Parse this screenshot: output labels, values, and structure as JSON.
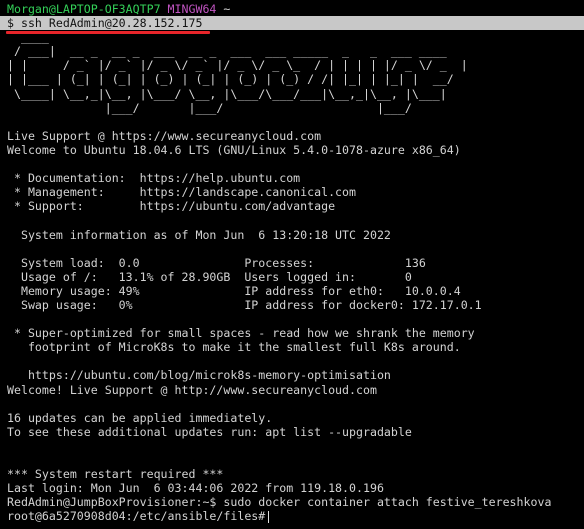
{
  "prompt": {
    "user_host": "Morgan@LAPTOP-OF3AQTP7",
    "shell": "MINGW64",
    "cwd": "~"
  },
  "command": "$ ssh RedAdmin@20.28.152.175",
  "colors": {
    "background": "#000000",
    "text": "#d3d3d3",
    "prompt_user": "#34d058",
    "prompt_shell": "#c154c1",
    "highlight": "#c8c8c8",
    "underline": "#e8252a"
  },
  "logo_art": [
    "  ____",
    " / ___|  __ _  __ _  ___  __ _  ___  ___ _____  _   _  ___ ____",
    "| |     / _` |/ _` |/ _ \\/ _` |/ _ \\/ _ \\_  / | | | | |/ _ \\/ _  |",
    "| |___ | (_| | (_| | (_) | (_| | (_) | (_) / /| |_| | |_| |  __/",
    " \\____| \\__,_|\\__, |\\___/ \\__, |\\___/\\___/___|\\__,_|\\__, |\\___|",
    "              |___/       |___/                      |___/"
  ],
  "output_lines": [
    "",
    "Live Support @ https://www.secureanycloud.com",
    "Welcome to Ubuntu 18.04.6 LTS (GNU/Linux 5.4.0-1078-azure x86_64)",
    "",
    " * Documentation:  https://help.ubuntu.com",
    " * Management:     https://landscape.canonical.com",
    " * Support:        https://ubuntu.com/advantage",
    "",
    "  System information as of Mon Jun  6 13:20:18 UTC 2022",
    "",
    "  System load:  0.0               Processes:             136",
    "  Usage of /:   13.1% of 28.90GB  Users logged in:       0",
    "  Memory usage: 49%               IP address for eth0:   10.0.0.4",
    "  Swap usage:   0%                IP address for docker0: 172.17.0.1",
    "",
    " * Super-optimized for small spaces - read how we shrank the memory",
    "   footprint of MicroK8s to make it the smallest full K8s around.",
    "",
    "   https://ubuntu.com/blog/microk8s-memory-optimisation",
    "Welcome! Live Support @ http://www.secureanycloud.com",
    "",
    "16 updates can be applied immediately.",
    "To see these additional updates run: apt list --upgradable",
    "",
    "",
    "*** System restart required ***",
    "Last login: Mon Jun  6 03:44:06 2022 from 119.18.0.196",
    "RedAdmin@JumpBoxProvisioner:~$ sudo docker container attach festive_tereshkova"
  ],
  "final_prompt": "root@6a5270908d04:/etc/ansible/files#"
}
